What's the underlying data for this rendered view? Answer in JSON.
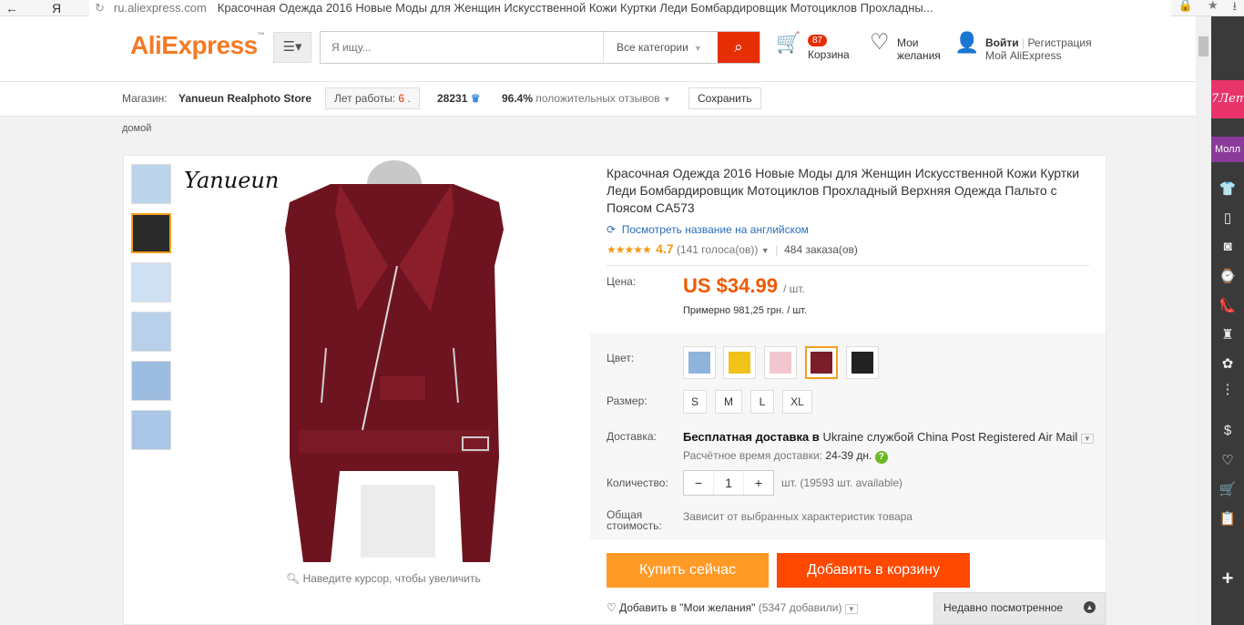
{
  "browser": {
    "back": "←",
    "ya": "Я",
    "domain": "ru.aliexpress.com",
    "tab_title": "Красочная Одежда 2016 Новые Моды для Женщин Искусственной Кожи Куртки Леди Бомбардировщик Мотоциклов Прохладны..."
  },
  "header": {
    "logo": "AliExpress",
    "search_placeholder": "Я ищу...",
    "category": "Все категории",
    "cart_count": "87",
    "cart_label": "Корзина",
    "wish_line1": "Мои",
    "wish_line2": "желания",
    "login": "Войти",
    "register": "Регистрация",
    "my_ali": "Мой AliExpress"
  },
  "store": {
    "label": "Магазин:",
    "name": "Yanueun Realphoto Store",
    "years_label": "Лет работы:",
    "years": "6",
    "score": "28231",
    "positive": "96.4%",
    "positive_label": "положительных отзывов",
    "save": "Сохранить"
  },
  "breadcrumb": "домой",
  "gallery": {
    "watermark": "Yanueun",
    "zoom_hint": "Наведите курсор, чтобы увеличить"
  },
  "product": {
    "title": "Красочная Одежда 2016 Новые Моды для Женщин Искусственной Кожи Куртки Леди Бомбардировщик Мотоциклов Прохладный Верхняя Одежда Пальто с Поясом CA573",
    "view_english": "Посмотреть название на английском",
    "rating": "4.7",
    "stars": "★★★★★",
    "votes": "(141 голоса(ов))",
    "orders": "484 заказа(ов)",
    "price_label": "Цена:",
    "price": "US $34.99",
    "price_unit": "/ шт.",
    "approx": "Примерно 981,25 грн. / шт.",
    "color_label": "Цвет:",
    "colors": [
      "#8fb4dc",
      "#f0c21a",
      "#f2c6cf",
      "#7a1e2a",
      "#222222"
    ],
    "size_label": "Размер:",
    "sizes": [
      "S",
      "M",
      "L",
      "XL"
    ],
    "ship_label": "Доставка:",
    "ship_free": "Бесплатная доставка в",
    "ship_rest": "Ukraine службой China Post Registered Air Mail",
    "eta_label": "Расчётное время доставки:",
    "eta": "24-39 дн.",
    "qty_label": "Количество:",
    "qty": "1",
    "qty_note": "шт. (19593 шт. available)",
    "total_label1": "Общая",
    "total_label2": "стоимость:",
    "total": "Зависит от выбранных характеристик товара",
    "buy_now": "Купить сейчас",
    "add_cart": "Добавить в корзину",
    "wish_add": "Добавить в \"Мои желания\"",
    "wish_count": "(5347 добавили)"
  },
  "recent": "Недавно посмотренное",
  "sidebar": {
    "seven": "7Лет",
    "mall": "Молл"
  },
  "colors": {
    "accent": "#f47a25",
    "search": "#e62e04",
    "buy": "#ff9a26",
    "cart": "#ff4800"
  }
}
